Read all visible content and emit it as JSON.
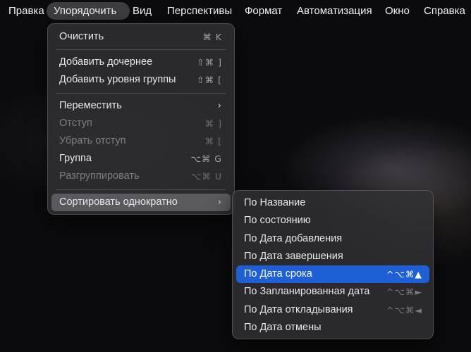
{
  "menubar": {
    "items": [
      {
        "label": "Правка"
      },
      {
        "label": "Упорядочить"
      },
      {
        "label": "Вид"
      },
      {
        "label": "Перспективы"
      },
      {
        "label": "Формат"
      },
      {
        "label": "Автоматизация"
      },
      {
        "label": "Окно"
      },
      {
        "label": "Справка"
      }
    ]
  },
  "organize_menu": {
    "items": [
      {
        "label": "Очистить",
        "shortcut": "⌘ K"
      },
      {
        "label": "Добавить дочернее",
        "shortcut": "⇧⌘ ]"
      },
      {
        "label": "Добавить уровня группы",
        "shortcut": "⇧⌘ ["
      },
      {
        "label": "Переместить",
        "submenu": "›"
      },
      {
        "label": "Отступ",
        "shortcut": "⌘ ]",
        "disabled": true
      },
      {
        "label": "Убрать отступ",
        "shortcut": "⌘ [",
        "disabled": true
      },
      {
        "label": "Группа",
        "shortcut": "⌥⌘ G"
      },
      {
        "label": "Разгруппировать",
        "shortcut": "⌥⌘ U",
        "disabled": true
      },
      {
        "label": "Сортировать однократно",
        "submenu": "›",
        "highlighted": true
      }
    ]
  },
  "sort_submenu": {
    "items": [
      {
        "label": "По Название"
      },
      {
        "label": "По состоянию"
      },
      {
        "label": "По Дата добавления"
      },
      {
        "label": "По Дата завершения"
      },
      {
        "label": "По Дата срока",
        "shortcut": "^⌥⌘▲",
        "highlighted": true
      },
      {
        "label": "По Запланированная дата",
        "shortcut": "^⌥⌘►"
      },
      {
        "label": "По Дата откладывания",
        "shortcut": "^⌥⌘◄"
      },
      {
        "label": "По Дата отмены"
      }
    ]
  },
  "colors": {
    "highlight_blue": "#1f5fd6",
    "menu_background": "#303034"
  }
}
